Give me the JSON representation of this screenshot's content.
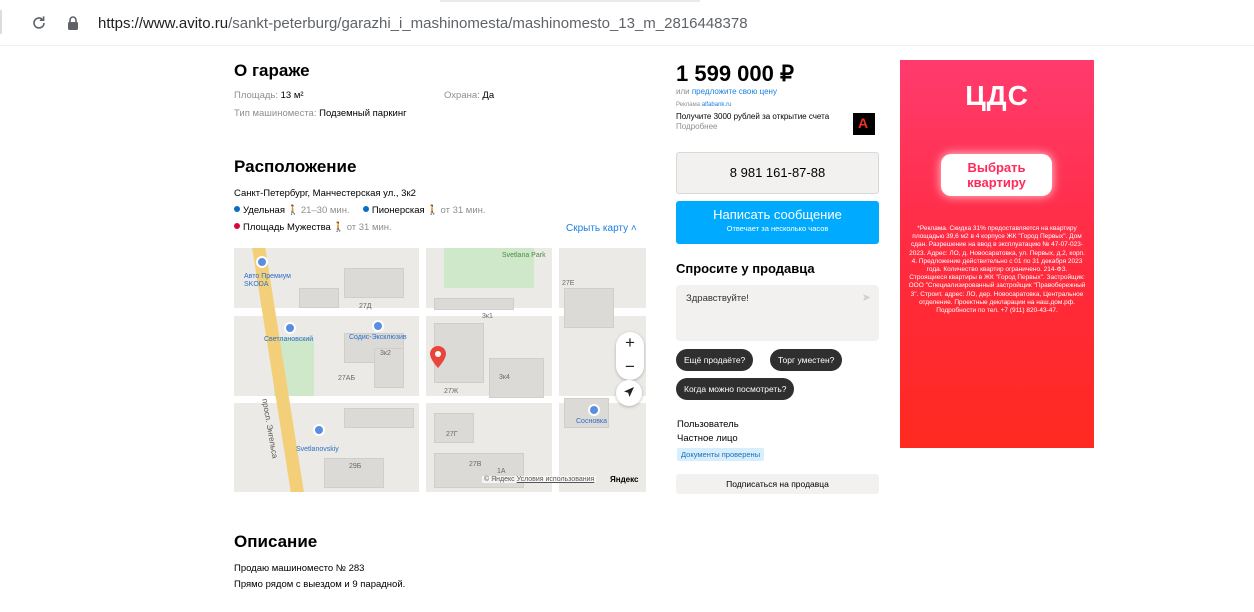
{
  "browser": {
    "url_domain": "https://www.avito.ru",
    "url_path": "/sankt-peterburg/garazhi_i_mashinomesta/mashinomesto_13_m_2816448378"
  },
  "garage": {
    "title": "О гараже",
    "area_label": "Площадь:",
    "area_value": "13 м²",
    "security_label": "Охрана:",
    "security_value": "Да",
    "type_label": "Тип машиноместа:",
    "type_value": "Подземный паркинг"
  },
  "location": {
    "title": "Расположение",
    "address": "Санкт-Петербург, Манчестерская ул., 3к2",
    "metro": [
      {
        "name": "Удельная",
        "time": "21–30 мин.",
        "color": "#0a6fc2"
      },
      {
        "name": "Пионерская",
        "time": "от 31 мин.",
        "color": "#0a6fc2"
      },
      {
        "name": "Площадь Мужества",
        "time": "от 31 мин.",
        "color": "#d6083b"
      }
    ],
    "hide_map": "Скрыть карту"
  },
  "map": {
    "labels": {
      "park": "Svetlana Park",
      "auto": "Авто Премиум SKODA",
      "svetl": "Светлановский",
      "sodis": "Содис-Эксклюзив",
      "prospect": "просп. Энгельса",
      "sosnovka": "Сосновка",
      "svetlanovskiy": "Svetlanovskiy",
      "n1": "27Д",
      "n2": "3к1",
      "n3": "3к2",
      "n4": "3к4",
      "n5": "27АБ",
      "n6": "27Е",
      "n7": "29Б",
      "n8": "27Г",
      "n9": "1А",
      "n10": "27Ж",
      "n11": "27В"
    },
    "copyright": "© Яндекс",
    "terms": "Условия использования",
    "brand": "Яндекс"
  },
  "description": {
    "title": "Описание",
    "line1": "Продаю машиноместо № 283",
    "line2": "Прямо рядом с выездом и 9 парадной."
  },
  "offer": {
    "price": "1 599 000 ₽",
    "or": "или",
    "propose": "предложите свою цену",
    "ad_label": "Реклама",
    "ad_domain": "alfabank.ru",
    "ad_text": "Получите 3000 рублей за открытие счета",
    "ad_more": "Подробнее",
    "phone": "8 981 161-87-88",
    "write_btn": "Написать сообщение",
    "write_sub": "Отвечает за несколько часов",
    "ask_title": "Спросите у продавца",
    "ask_placeholder": "Здравствуйте!",
    "chips": [
      "Ещё продаёте?",
      "Торг уместен?",
      "Когда можно посмотреть?"
    ],
    "seller_name": "Пользователь",
    "seller_type": "Частное лицо",
    "verified": "Документы проверены",
    "subscribe": "Подписаться на продавца"
  },
  "banner": {
    "logo": "ЦДС",
    "cta": "Выбрать квартиру",
    "fine": "*Реклама. Скидка 31% предоставляется на квартиру площадью 39,6 м2 в 4 корпусе ЖК \"Город Первых\". Дом сдан. Разрешение на ввод в эксплуатацию № 47-07-023-2023. Адрес: ЛО, д. Новосаратовка, ул. Первых, д.2, корп. 4. Предложение действительно с 01 по 31 декабря 2023 года. Количество квартир ограничено. 214-ФЗ. Строящиеся квартиры в ЖК \"Город Первых\". Застройщик: ООО \"Специализированный застройщик \"Правобережный 3\". Строит. адрес: ЛО, дер. Новосаратовка, Центральное отделение. Проектные декларации на наш.дом.рф. Подробности по тел. +7 (911) 820-43-47."
  },
  "colors": {
    "accent": "#00aaff",
    "link": "#1b7fe0",
    "banner": "#ff2a3c"
  }
}
